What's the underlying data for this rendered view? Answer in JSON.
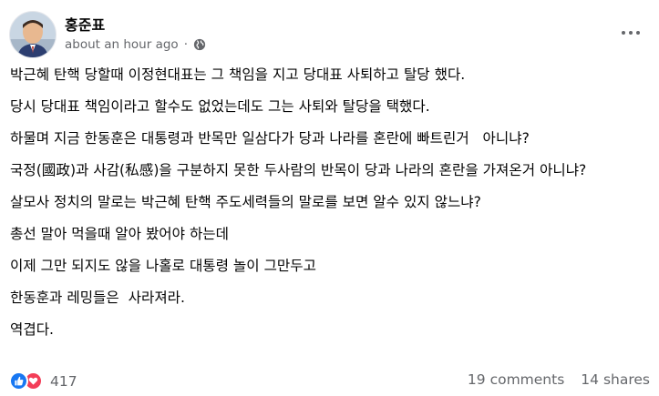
{
  "post": {
    "author": "홍준표",
    "timestamp": "about an hour ago",
    "separator": "·",
    "privacy_icon": "globe-icon",
    "more_icon": "more-horizontal-icon",
    "paragraphs": [
      "박근혜 탄핵 당할때 이정현대표는 그 책임을 지고 당대표 사퇴하고 탈당 했다.",
      "당시 당대표 책임이라고 할수도 없었는데도 그는 사퇴와 탈당을 택했다.",
      "하물며 지금 한동훈은 대통령과 반목만 일삼다가 당과 나라를 혼란에 빠트린거   아니냐?",
      "국정(國政)과 사감(私感)을 구분하지 못한 두사람의 반목이 당과 나라의 혼란을 가져온거 아니냐?",
      "살모사 정치의 말로는 박근혜 탄핵 주도세력들의 말로를 보면 알수 있지 않느냐?",
      "총선 말아 먹을때 알아 봤어야 하는데",
      "이제 그만 되지도 않을 나홀로 대통령 놀이 그만두고",
      "한동훈과 레밍들은  사라져라.",
      "역겹다."
    ]
  },
  "footer": {
    "reaction_icons": [
      "like-icon",
      "love-icon"
    ],
    "reaction_count": "417",
    "comments": "19 comments",
    "shares": "14 shares"
  },
  "colors": {
    "text": "#050505",
    "secondary": "#65676b",
    "like": "#1877f2",
    "love": "#f33e58"
  }
}
